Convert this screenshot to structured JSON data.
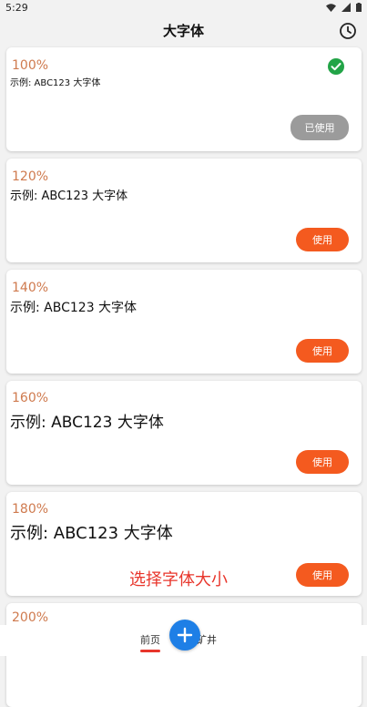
{
  "status": {
    "time": "5:29"
  },
  "app": {
    "title": "大字体"
  },
  "cards": [
    {
      "percent": "100%",
      "sample": "示例: ABC123 大字体",
      "button": "已使用",
      "used": true
    },
    {
      "percent": "120%",
      "sample": "示例: ABC123 大字体",
      "button": "使用",
      "used": false
    },
    {
      "percent": "140%",
      "sample": "示例: ABC123 大字体",
      "button": "使用",
      "used": false
    },
    {
      "percent": "160%",
      "sample": "示例: ABC123 大字体",
      "button": "使用",
      "used": false
    },
    {
      "percent": "180%",
      "sample": "示例: ABC123 大字体",
      "button": "使用",
      "used": false
    },
    {
      "percent": "200%"
    }
  ],
  "caption": "选择字体大小",
  "nav": {
    "home": "前页",
    "partial": "矿井"
  },
  "colors": {
    "accent": "#f45a1f",
    "percent": "#cf7a4e",
    "used_button": "#9b9b9b",
    "fab": "#1e7fe6",
    "check": "#22a447",
    "caption": "#e8352b"
  }
}
